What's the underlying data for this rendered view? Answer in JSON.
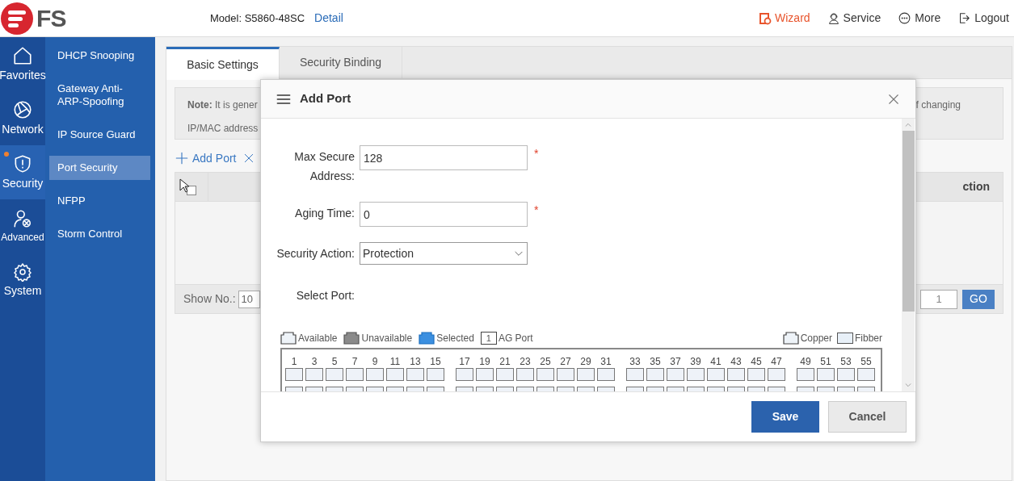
{
  "header": {
    "logo_text": "FS",
    "model": "Model: S5860-48SC",
    "detail_link": "Detail",
    "actions": [
      {
        "kind": "wizard",
        "label": "Wizard"
      },
      {
        "kind": "service",
        "label": "Service"
      },
      {
        "kind": "more",
        "label": "More"
      },
      {
        "kind": "logout",
        "label": "Logout"
      }
    ]
  },
  "rail": [
    {
      "kind": "home",
      "label": "Favorites",
      "selected": false,
      "alert": false
    },
    {
      "kind": "network",
      "label": "Network",
      "selected": false,
      "alert": false
    },
    {
      "kind": "security",
      "label": "Security",
      "selected": true,
      "alert": true
    },
    {
      "kind": "advanced",
      "label": "Advanced",
      "selected": false,
      "alert": false
    },
    {
      "kind": "system",
      "label": "System",
      "selected": false,
      "alert": false
    }
  ],
  "submenu": [
    {
      "label": "DHCP Snooping",
      "selected": false
    },
    {
      "label": "Gateway Anti-ARP-Spoofing",
      "selected": false
    },
    {
      "label": "IP Source Guard",
      "selected": false
    },
    {
      "label": "Port Security",
      "selected": true
    },
    {
      "label": "NFPP",
      "selected": false
    },
    {
      "label": "Storm Control",
      "selected": false
    }
  ],
  "tabs": [
    {
      "label": "Basic Settings",
      "selected": true
    },
    {
      "label": "Security Binding",
      "selected": false
    }
  ],
  "note": {
    "line_1": "**Note:** It is gener",
    "line_2": "IP/MAC address",
    "line_1_end": "f changing"
  },
  "toolbar": {
    "add": "Add Port"
  },
  "table": {
    "select_all_checked": false,
    "column_2": "ction"
  },
  "pager": {
    "show_label": "Show No.:",
    "show_value": "10",
    "page_value": "1",
    "go": "GO"
  },
  "dialog": {
    "title": "Add Port",
    "fields": [
      {
        "kind": "text",
        "label": "Max Secure Address:",
        "value": "128",
        "required_mark": "*"
      },
      {
        "kind": "text",
        "label": "Aging Time:",
        "value": "0",
        "required_mark": "*"
      },
      {
        "kind": "select",
        "label": "Security Action:",
        "value": "Protection"
      }
    ],
    "select_port_label": "Select Port:",
    "legend": [
      {
        "kind": "available",
        "label": "Available"
      },
      {
        "kind": "unavailable",
        "label": "Unavailable"
      },
      {
        "kind": "selected",
        "label": "Selected"
      },
      {
        "kind": "ag",
        "label": "AG Port",
        "mark": "1"
      }
    ],
    "media_legend": [
      {
        "kind": "copper",
        "label": "Copper"
      },
      {
        "kind": "fiber",
        "label": "Fibber"
      }
    ],
    "port_groups": [
      [
        "1",
        "3",
        "5",
        "7",
        "9",
        "11",
        "13",
        "15"
      ],
      [
        "17",
        "19",
        "21",
        "23",
        "25",
        "27",
        "29",
        "31"
      ],
      [
        "33",
        "35",
        "37",
        "39",
        "41",
        "43",
        "45",
        "47"
      ],
      [
        "49",
        "51",
        "53",
        "55"
      ]
    ],
    "buttons": [
      {
        "kind": "primary",
        "label": "Save"
      },
      {
        "kind": "secondary",
        "label": "Cancel"
      }
    ]
  }
}
